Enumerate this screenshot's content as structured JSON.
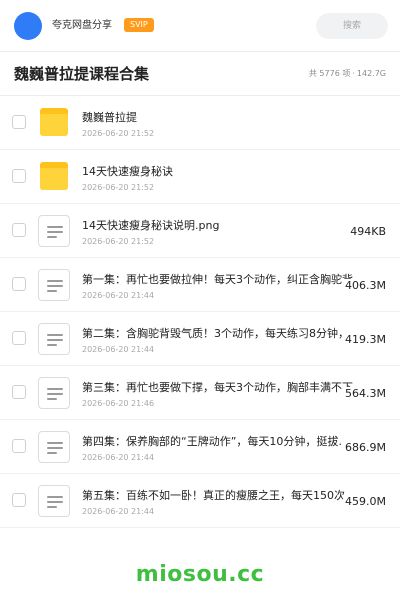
{
  "topbar": {
    "brand": "夸克网盘分享",
    "badge": "SVIP",
    "search_placeholder": "搜索"
  },
  "header": {
    "title": "魏巍普拉提课程合集",
    "count": "共 5776 项",
    "separator": "·",
    "total_size": "142.7G"
  },
  "files": [
    {
      "type": "folder",
      "name": "魏巍普拉提",
      "date": "2026-06-20 21:52",
      "size": ""
    },
    {
      "type": "folder",
      "name": "14天快速瘦身秘诀",
      "date": "2026-06-20 21:52",
      "size": ""
    },
    {
      "type": "file",
      "name": "14天快速瘦身秘诀说明.png",
      "date": "2026-06-20 21:52",
      "size": "494KB"
    },
    {
      "type": "file",
      "name": "第一集：再忙也要做拉伸！每天3个动作，纠正含胸驼背",
      "date": "2026-06-20 21:44",
      "size": "406.3M"
    },
    {
      "type": "file",
      "name": "第二集：含胸驼背毁气质！3个动作，每天练习8分钟，",
      "date": "2026-06-20 21:44",
      "size": "419.3M"
    },
    {
      "type": "file",
      "name": "第三集：再忙也要做下撑，每天3个动作，胸部丰满不下",
      "date": "2026-06-20 21:46",
      "size": "564.3M"
    },
    {
      "type": "file",
      "name": "第四集：保养胸部的“王牌动作”，每天10分钟，挺拔…",
      "date": "2026-06-20 21:44",
      "size": "686.9M"
    },
    {
      "type": "file",
      "name": "第五集：百练不如一卧！真正的瘦腰之王，每天150次…",
      "date": "2026-06-20 21:44",
      "size": "459.0M"
    }
  ],
  "watermark": "miosou.cc",
  "colors": {
    "avatar": "#2f7cf6",
    "badge": "#ff9b1a",
    "folder": "#ffc21a",
    "watermark": "#3fbf3f"
  }
}
